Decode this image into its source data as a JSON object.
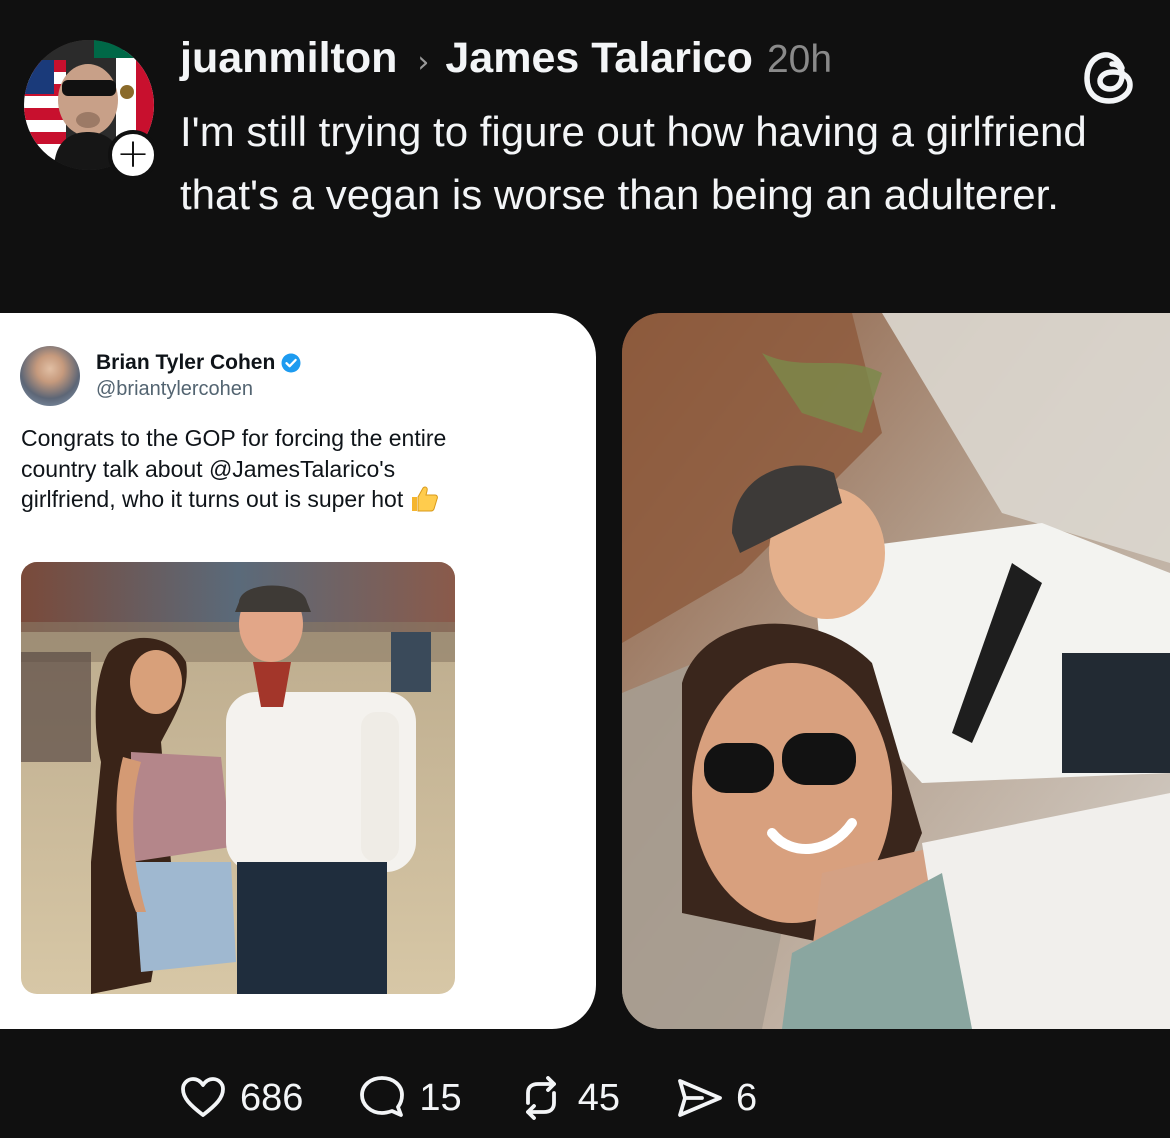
{
  "post": {
    "author": "juanmilton",
    "separator": "›",
    "reply_to": "James Talarico",
    "time": "20h",
    "text": "I'm still trying to figure out how having a girlfriend that's a vegan is worse than being an adulterer.",
    "follow_label": "+"
  },
  "embedded_tweet": {
    "name": "Brian Tyler Cohen",
    "handle": "@briantylercohen",
    "text": "Congrats to the GOP for forcing the entire country talk about @JamesTalarico's girlfriend, who it turns out is super hot"
  },
  "actions": {
    "likes": "686",
    "replies": "15",
    "reposts": "45",
    "shares": "6"
  },
  "icons": {
    "app": "threads-logo-icon",
    "like": "heart-icon",
    "reply": "comment-icon",
    "repost": "repost-icon",
    "share": "send-icon",
    "verified": "verified-badge-icon",
    "emoji": "thumbs-up-icon"
  },
  "colors": {
    "background": "#101010",
    "text": "#f3f5f7",
    "muted": "#8a8a8a",
    "verified": "#1d9bf0"
  }
}
